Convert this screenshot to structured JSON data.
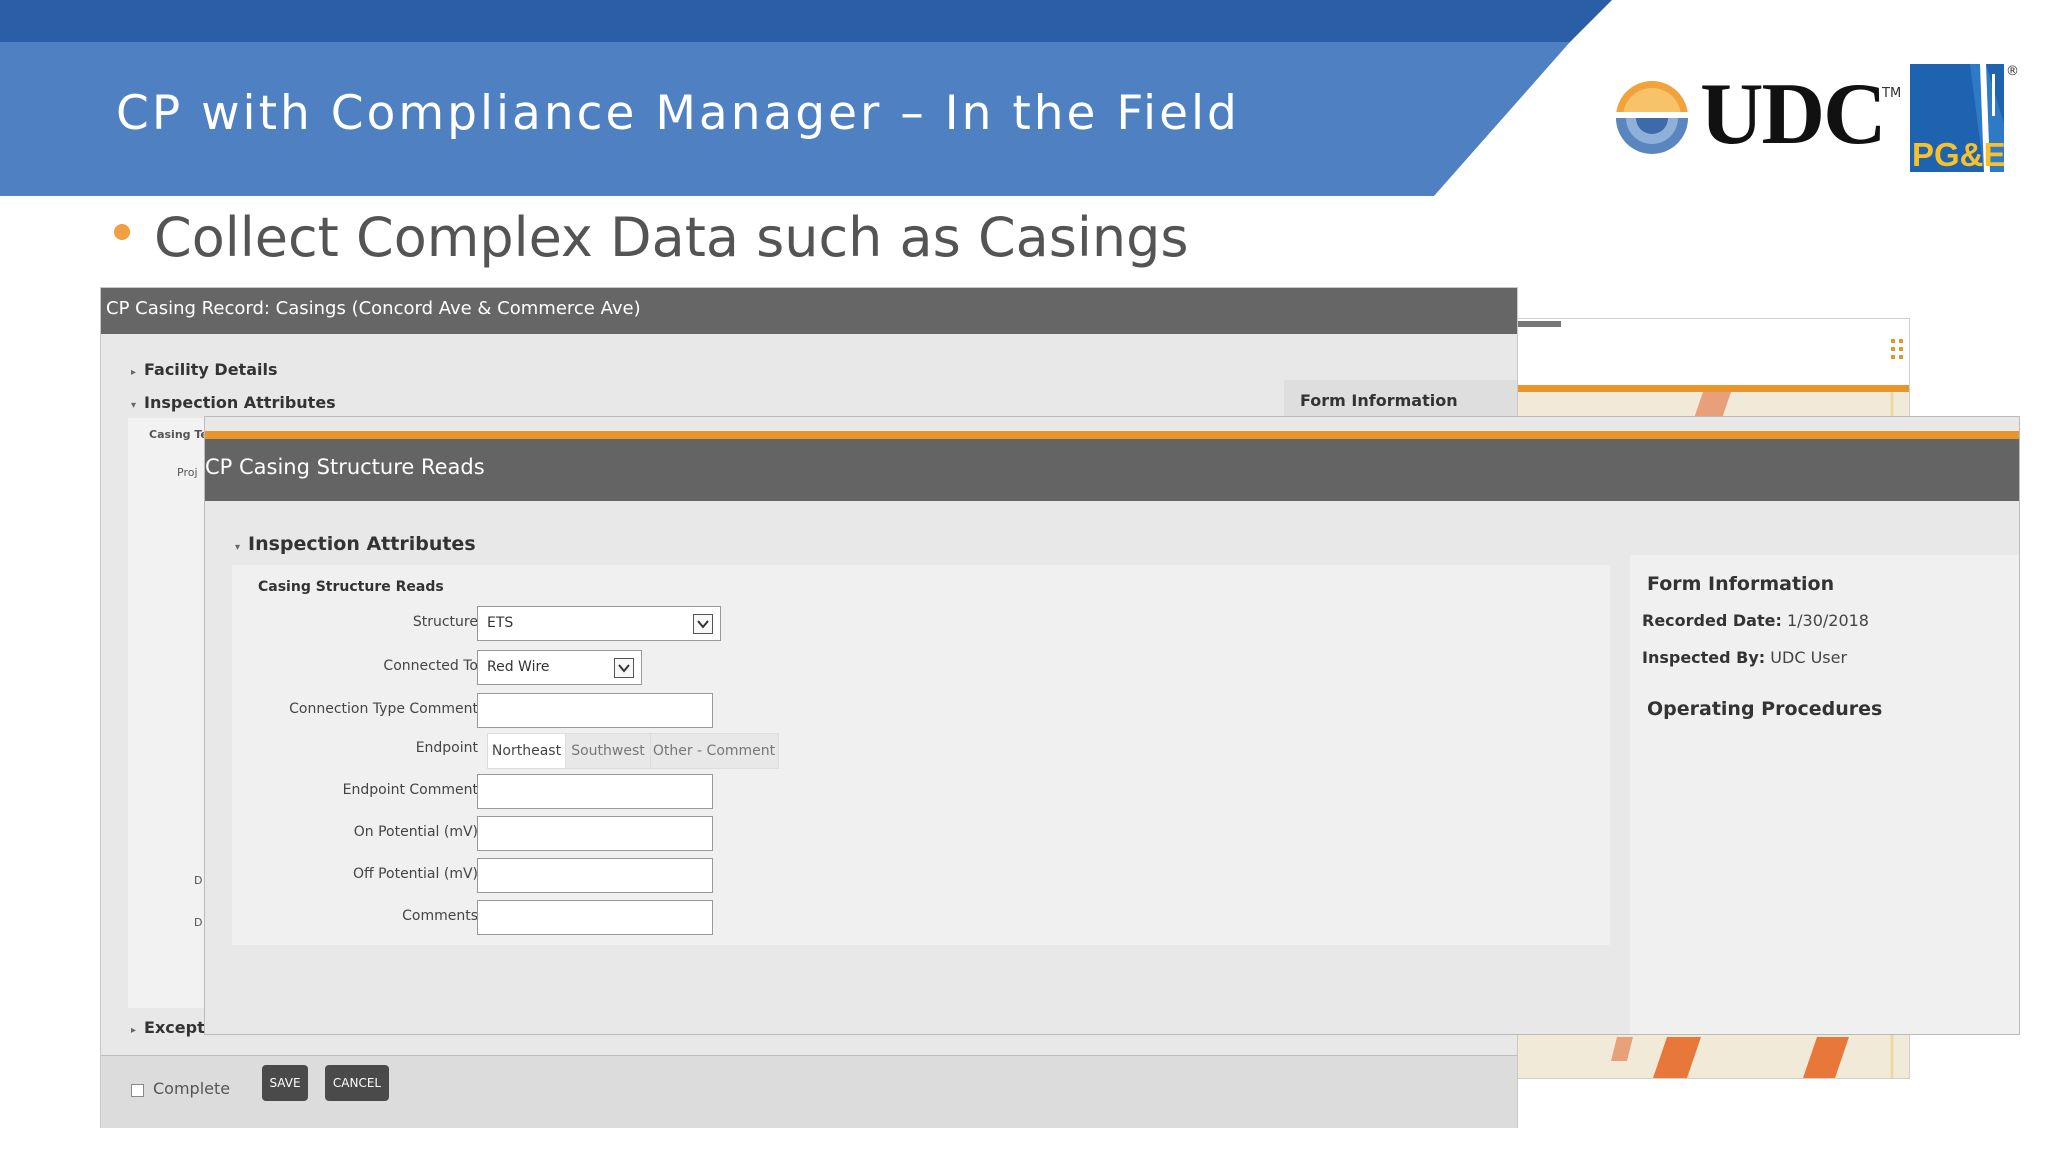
{
  "slide": {
    "title": "CP with Compliance Manager – In the Field",
    "bullet": "Collect Complex Data such as Casings",
    "colors": {
      "header_dark": "#2a5ea6",
      "header_light": "#4f80c2",
      "bullet": "#f0a042"
    }
  },
  "logos": {
    "udc": "UDC",
    "udc_tm": "TM",
    "pge": "PG&E",
    "pge_reg": "®"
  },
  "back_window": {
    "title": "CP Casing Record: Casings (Concord Ave & Commerce Ave)",
    "tree": {
      "facility_details": "Facility Details",
      "inspection_attributes": "Inspection Attributes",
      "exceptions_partial": "Excepti"
    },
    "partial_labels": {
      "casing_type": "Casing Te",
      "proj": "Proj"
    },
    "form_information": "Form Information",
    "complete_label": "Complete",
    "save_label": "SAVE",
    "cancel_label": "CANCEL"
  },
  "front_window": {
    "title": "CP Casing Structure Reads",
    "section": "Inspection Attributes",
    "subsection": "Casing Structure Reads",
    "fields": {
      "structure": {
        "label": "Structure",
        "value": "ETS"
      },
      "connected_to": {
        "label": "Connected To",
        "value": "Red Wire"
      },
      "connection_type_comment": {
        "label": "Connection Type Comment",
        "value": ""
      },
      "endpoint": {
        "label": "Endpoint",
        "options": [
          "Northeast",
          "Southwest",
          "Other - Comment"
        ],
        "selected": "Northeast"
      },
      "endpoint_comment": {
        "label": "Endpoint Comment",
        "value": ""
      },
      "on_potential": {
        "label": "On Potential (mV)",
        "value": ""
      },
      "off_potential": {
        "label": "Off Potential (mV)",
        "value": ""
      },
      "comments": {
        "label": "Comments",
        "value": ""
      }
    },
    "side_panel": {
      "form_information": "Form Information",
      "recorded_date_label": "Recorded Date:",
      "recorded_date": "1/30/2018",
      "inspected_by_label": "Inspected By:",
      "inspected_by": "UDC User",
      "operating_procedures": "Operating Procedures"
    }
  }
}
